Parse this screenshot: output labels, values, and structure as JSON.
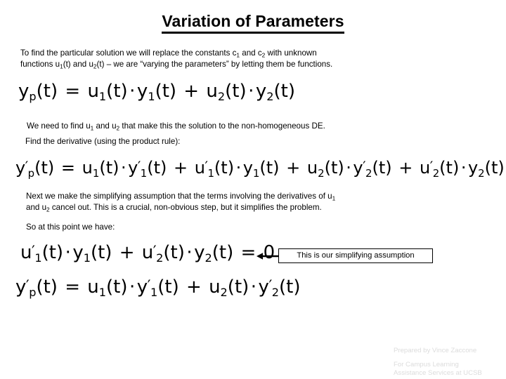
{
  "slide": {
    "title": "Variation of Parameters",
    "background_color": "#ffffff",
    "text_color": "#000000",
    "credit_color": "#dcdcdc"
  },
  "intro": {
    "line1": "To find the particular solution we will replace the constants c",
    "line1_sub1": "1",
    "line1_mid": " and c",
    "line1_sub2": "2",
    "line1_end": " with unknown",
    "line2": "functions u",
    "line2_sub1": "1",
    "line2_mid": "(t) and u",
    "line2_sub2": "2",
    "line2_end": "(t) – we are “varying the parameters” by letting them be functions."
  },
  "equations": {
    "eq1": {
      "lhs_base": "y",
      "lhs_sub": "p",
      "lhs_tail": "(t)",
      "eq": "=",
      "full_text": "y_p(t) = u_1(t) · y_1(t) + u_2(t) · y_2(t)",
      "terms": [
        {
          "base": "u",
          "sub": "1",
          "tail": "(t)"
        },
        {
          "base": "y",
          "sub": "1",
          "tail": "(t)"
        },
        {
          "base": "u",
          "sub": "2",
          "tail": "(t)"
        },
        {
          "base": "y",
          "sub": "2",
          "tail": "(t)"
        }
      ]
    },
    "eq2": {
      "full_text": "y′_p(t) = u_1(t) · y′_1(t) + u′_1(t) · y_1(t) + u_2(t) · y′_2(t) + u′_2(t) · y_2(t)"
    },
    "eq3": {
      "full_text": "u′_1(t) · y_1(t) + u′_2(t) · y_2(t) = 0",
      "rhs": "0"
    },
    "eq4": {
      "full_text": "y′_p(t) = u_1(t) · y′_1(t) + u_2(t) · y′_2(t)"
    }
  },
  "notes": {
    "need_line": "We need to find u",
    "need_sub1": "1",
    "need_mid": " and u",
    "need_sub2": "2",
    "need_end": " that make this the solution to the non-homogeneous DE.",
    "find_derivative": "Find the derivative (using the product rule):",
    "next_line1": "Next we make the simplifying assumption that the terms involving the derivatives of u",
    "next_sub1": "1",
    "next_line2": "and u",
    "next_sub2": "2",
    "next_line2_end": " cancel out. This is a crucial, non-obvious step, but it simplifies the problem.",
    "so_at_this_point": "So at this point we have:"
  },
  "callout": {
    "label": "This is our simplifying assumption",
    "arrow_direction": "left"
  },
  "credit": {
    "line1": "Prepared by Vince Zaccone",
    "line2": "For Campus Learning",
    "line3": "Assistance Services at UCSB"
  }
}
